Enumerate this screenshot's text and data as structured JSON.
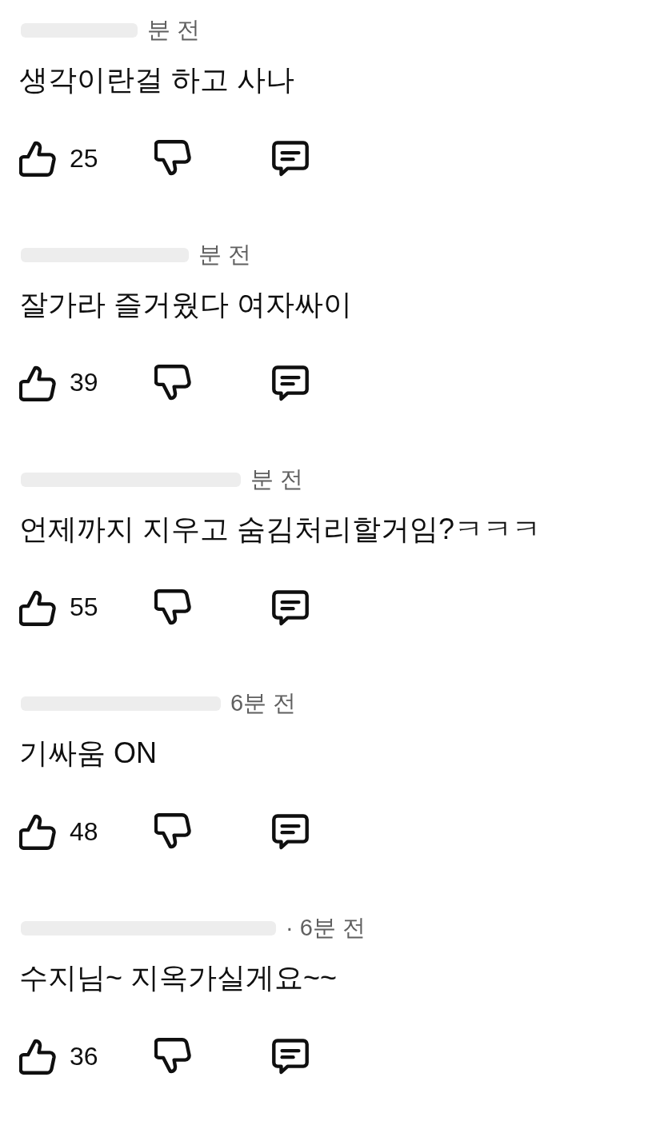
{
  "comments": [
    {
      "username_redacted": true,
      "time": "분 전",
      "body": "생각이란걸 하고 사나",
      "likes": "25"
    },
    {
      "username_redacted": true,
      "time": "분 전",
      "body": "잘가라 즐거웠다 여자싸이",
      "likes": "39"
    },
    {
      "username_redacted": true,
      "time": "분 전",
      "body": "언제까지 지우고 숨김처리할거임?ㅋㅋㅋ",
      "likes": "55"
    },
    {
      "username_redacted": true,
      "time": "6분 전",
      "body": "기싸움 ON",
      "likes": "48"
    },
    {
      "username_redacted": true,
      "time": "· 6분 전",
      "body": "수지님~ 지옥가실게요~~",
      "likes": "36"
    }
  ]
}
